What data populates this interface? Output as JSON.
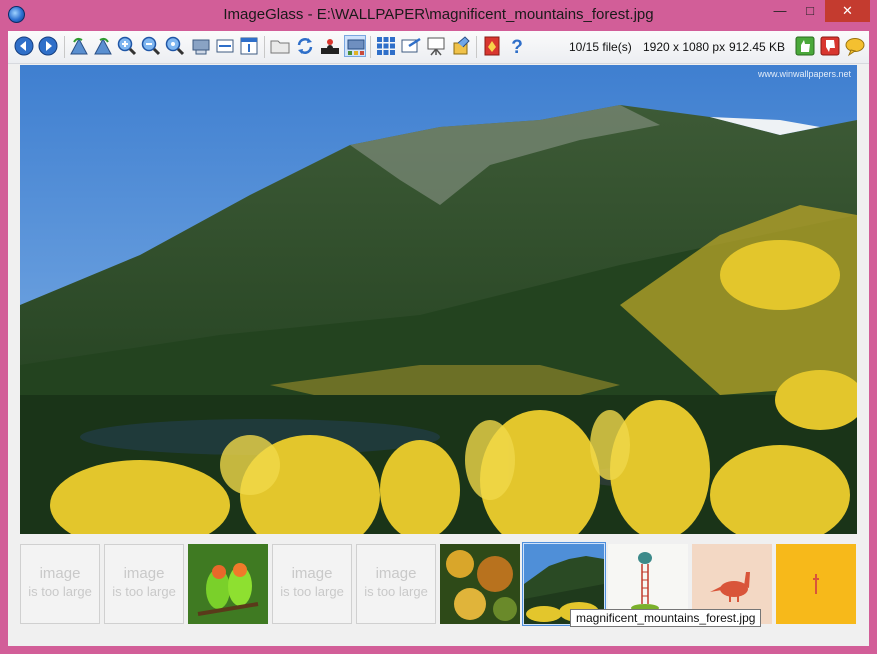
{
  "window": {
    "title": "ImageGlass - E:\\WALLPAPER\\magnificent_mountains_forest.jpg",
    "minimize_glyph": "—",
    "maximize_glyph": "□",
    "close_glyph": "✕"
  },
  "toolbar": {
    "buttons": [
      {
        "name": "back-icon"
      },
      {
        "name": "forward-icon"
      },
      {
        "name": "rotate-left-icon"
      },
      {
        "name": "rotate-right-icon"
      },
      {
        "name": "zoom-in-icon"
      },
      {
        "name": "zoom-out-icon"
      },
      {
        "name": "actual-size-icon"
      },
      {
        "name": "lock-zoom-icon"
      },
      {
        "name": "scale-width-icon"
      },
      {
        "name": "scale-height-icon"
      },
      {
        "name": "open-folder-icon"
      },
      {
        "name": "refresh-icon"
      },
      {
        "name": "goto-image-icon"
      },
      {
        "name": "thumbnail-bar-icon"
      },
      {
        "name": "checkerboard-icon"
      },
      {
        "name": "set-wallpaper-icon"
      },
      {
        "name": "slideshow-icon"
      },
      {
        "name": "extension-icon"
      },
      {
        "name": "settings-icon"
      },
      {
        "name": "help-icon"
      },
      {
        "name": "like-icon"
      },
      {
        "name": "dislike-icon"
      },
      {
        "name": "feedback-icon"
      }
    ],
    "file_count": "10/15 file(s)",
    "dimensions": "1920 x 1080 px",
    "file_size": "912.45 KB"
  },
  "viewer": {
    "watermark": "www.winwallpapers.net",
    "colors": {
      "sky": "#4f8fd8",
      "forest": "#22401f",
      "aspen": "#e3c62c"
    }
  },
  "thumbnails": {
    "placeholder_line1": "image",
    "placeholder_line2": "is too large",
    "items": [
      {
        "kind": "placeholder"
      },
      {
        "kind": "placeholder"
      },
      {
        "kind": "parrots"
      },
      {
        "kind": "placeholder"
      },
      {
        "kind": "placeholder"
      },
      {
        "kind": "autumn-leaves"
      },
      {
        "kind": "mountains",
        "selected": true
      },
      {
        "kind": "ladder"
      },
      {
        "kind": "dinosaur"
      },
      {
        "kind": "yellow"
      }
    ]
  },
  "tooltip": "magnificent_mountains_forest.jpg"
}
